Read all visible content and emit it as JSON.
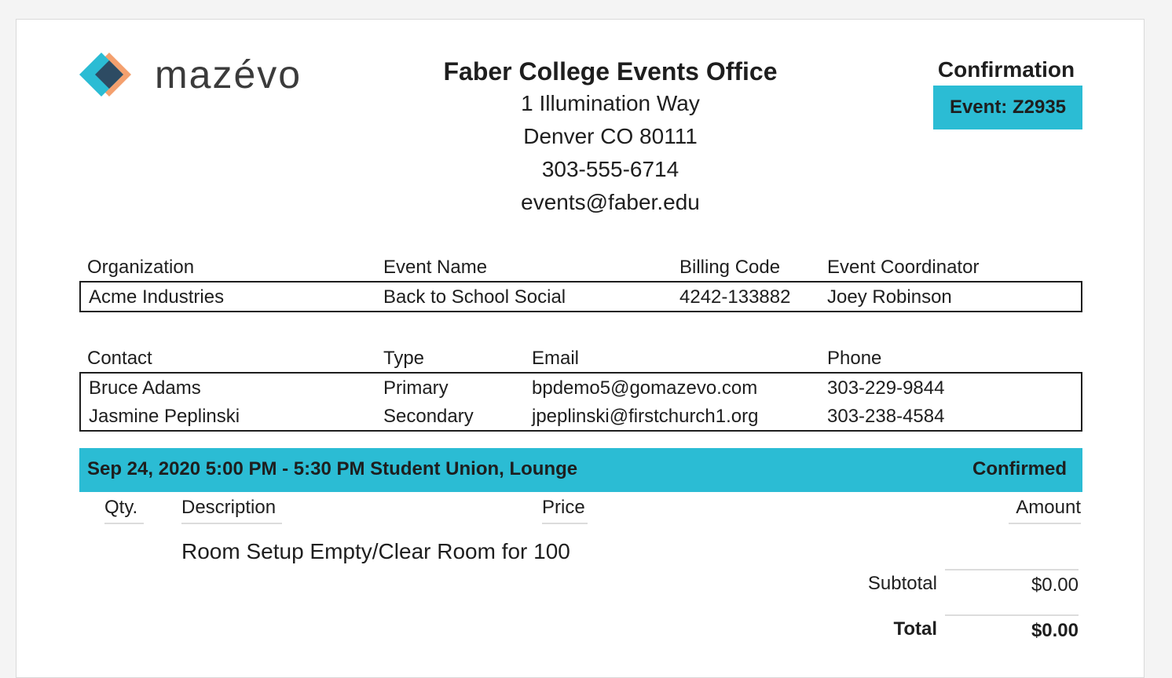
{
  "brand": {
    "name": "mazévo",
    "colors": {
      "teal": "#2bbcd4",
      "dark": "#2d4b63",
      "orange": "#f4a06e"
    }
  },
  "office": {
    "name": "Faber College Events Office",
    "address1": "1 Illumination Way",
    "address2": "Denver CO 80111",
    "phone": "303-555-6714",
    "email": "events@faber.edu"
  },
  "confirmation": {
    "title": "Confirmation",
    "event_label": "Event: Z2935"
  },
  "event_info": {
    "headers": {
      "organization": "Organization",
      "event_name": "Event Name",
      "billing_code": "Billing Code",
      "coordinator": "Event Coordinator"
    },
    "values": {
      "organization": "Acme Industries",
      "event_name": "Back to School Social",
      "billing_code": "4242-133882",
      "coordinator": "Joey Robinson"
    }
  },
  "contacts": {
    "headers": {
      "contact": "Contact",
      "type": "Type",
      "email": "Email",
      "phone": "Phone"
    },
    "rows": [
      {
        "contact": "Bruce Adams",
        "type": "Primary",
        "email": "bpdemo5@gomazevo.com",
        "phone": "303-229-9844"
      },
      {
        "contact": "Jasmine Peplinski",
        "type": "Secondary",
        "email": "jpeplinski@firstchurch1.org",
        "phone": "303-238-4584"
      }
    ]
  },
  "booking": {
    "summary": "Sep 24, 2020 5:00 PM - 5:30 PM Student Union, Lounge",
    "status": "Confirmed",
    "columns": {
      "qty": "Qty.",
      "description": "Description",
      "price": "Price",
      "amount": "Amount"
    },
    "item": "Room Setup Empty/Clear Room for 100",
    "subtotal_label": "Subtotal",
    "subtotal_value": "$0.00",
    "total_label": "Total",
    "total_value": "$0.00"
  }
}
